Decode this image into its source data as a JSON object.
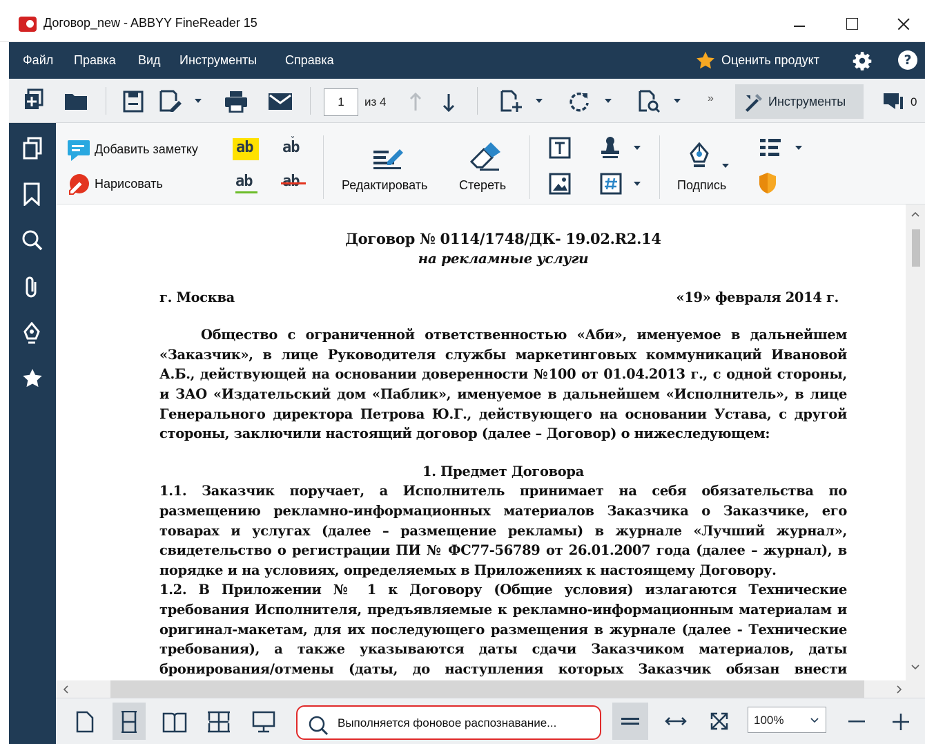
{
  "window": {
    "title": "Договор_new - ABBYY FineReader 15"
  },
  "menu": {
    "items": [
      "Файл",
      "Правка",
      "Вид",
      "Инструменты",
      "Справка"
    ],
    "rate_label": "Оценить продукт"
  },
  "toolbar": {
    "page_current": "1",
    "page_of": "из 4",
    "overflow": "»",
    "tools_label": "Инструменты",
    "comments_count": "0"
  },
  "ribbon": {
    "add_note": "Добавить заметку",
    "draw": "Нарисовать",
    "highlight_ab": "ab",
    "edit": "Редактировать",
    "erase": "Стереть",
    "signature": "Подпись"
  },
  "document": {
    "title": "Договор № 0114/1748/ДК- 19.02.R2.14",
    "subtitle": "на рекламные услуги",
    "city": "г. Москва",
    "date": "«19» февраля 2014 г.",
    "intro": "Общество с ограниченной ответственностью «Аби», именуемое в дальнейшем «Заказчик», в лице Руководителя службы маркетинговых коммуникаций Ивановой А.Б., действующей на основании доверенности №100 от 01.04.2013 г., с одной стороны, и ЗАО «Издательский дом «Паблик», именуемое в дальнейшем «Исполнитель», в лице Генерального директора Петрова Ю.Г., действующего на основании Устава, с другой стороны, заключили настоящий договор (далее – Договор) о нижеследующем:",
    "section1_title": "1.  Предмет Договора",
    "p1_1": "1.1. Заказчик поручает, а Исполнитель принимает на себя обязательства по размещению рекламно-информационных материалов Заказчика о Заказчике, его товарах и услугах (далее – размещение рекламы) в журнале «Лучший журнал», свидетельство о регистрации ПИ № ФС77-56789 от 26.01.2007 года (далее – журнал), в порядке и на условиях, определяемых в Приложениях к настоящему Договору.",
    "p1_2": "1.2. В Приложении № 1 к Договору (Общие условия) излагаются Технические требования Исполнителя, предъявляемые к рекламно-информационным материалам и оригинал-макетам, для их последующего размещения в журнале (далее - Технические требования), а также указываются даты сдачи Заказчиком материалов, даты бронирования/отмены (даты, до наступления которых Заказчик обязан внести возможные изменения в"
  },
  "statusbar": {
    "recognition_status": "Выполняется фоновое распознавание...",
    "zoom": "100%"
  },
  "colors": {
    "menubar_bg": "#203b55",
    "highlight_status_border": "#e02a2a",
    "note_icon": "#29a8e0",
    "highlight_yellow": "#ffe100"
  }
}
